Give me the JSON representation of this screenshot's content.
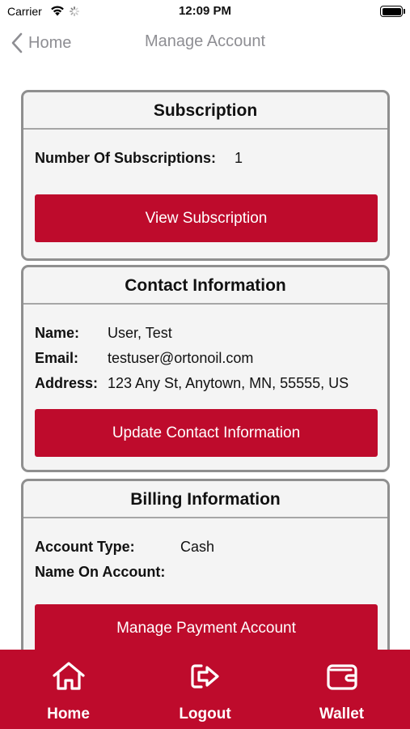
{
  "status_bar": {
    "carrier": "Carrier",
    "time": "12:09 PM",
    "battery_level": 1.0
  },
  "nav": {
    "back_label": "Home",
    "title": "Manage Account"
  },
  "subscription": {
    "title": "Subscription",
    "count_label": "Number Of Subscriptions:",
    "count_value": "1",
    "button_label": "View Subscription"
  },
  "contact": {
    "title": "Contact Information",
    "name_label": "Name:",
    "name_value": "User, Test",
    "email_label": "Email:",
    "email_value": "testuser@ortonoil.com",
    "address_label": "Address:",
    "address_value": "123 Any St, Anytown, MN, 55555, US",
    "button_label": "Update Contact Information"
  },
  "billing": {
    "title": "Billing Information",
    "account_type_label": "Account Type:",
    "account_type_value": "Cash",
    "name_on_account_label": "Name On Account:",
    "name_on_account_value": "",
    "button_label": "Manage Payment Account"
  },
  "tabs": [
    {
      "label": "Home",
      "icon": "home-icon"
    },
    {
      "label": "Logout",
      "icon": "logout-icon"
    },
    {
      "label": "Wallet",
      "icon": "wallet-icon"
    }
  ],
  "colors": {
    "accent": "#be0b2c",
    "card_background": "#f4f4f4",
    "card_border": "#8f8f8f",
    "nav_text": "#8e8e93"
  }
}
